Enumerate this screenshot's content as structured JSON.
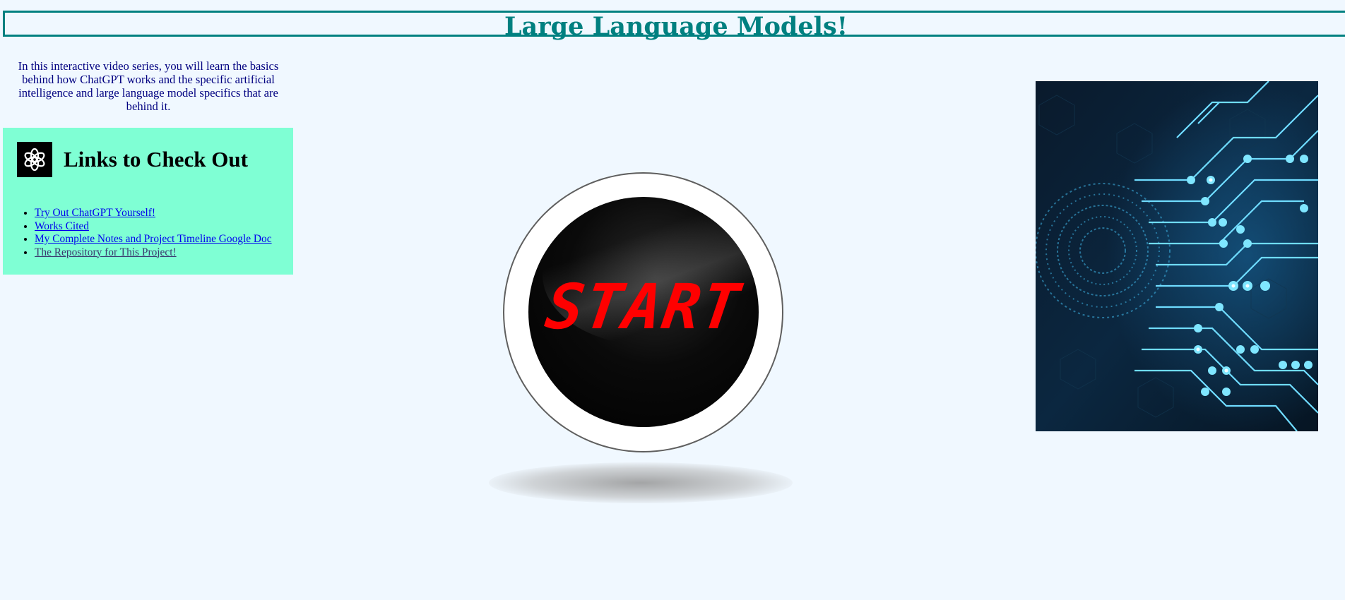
{
  "header": {
    "title": "Large Language Models!"
  },
  "intro": {
    "text": "In this interactive video series, you will learn the basics behind how ChatGPT works and the specific artificial intelligence and large language model specifics that are behind it."
  },
  "links_section": {
    "heading": "Links to Check Out",
    "logo_icon": "openai-logo-icon",
    "items": [
      {
        "label": "Try Out ChatGPT Yourself!"
      },
      {
        "label": "Works Cited"
      },
      {
        "label": "My Complete Notes and Project Timeline Google Doc"
      },
      {
        "label": "The Repository for This Project!"
      }
    ]
  },
  "start_button": {
    "label": "START"
  },
  "colors": {
    "background": "#f0f8ff",
    "title": "#008080",
    "intro_text": "#000080",
    "links_box": "#7fffd4",
    "start_text": "#ff0000"
  }
}
